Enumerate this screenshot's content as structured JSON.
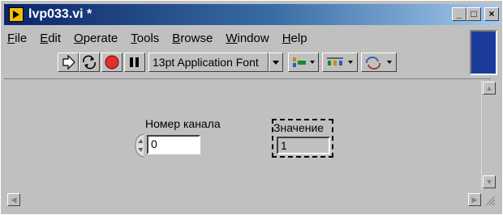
{
  "window": {
    "title": "lvp033.vi *",
    "min_glyph": "_",
    "max_glyph": "□",
    "close_glyph": "×"
  },
  "menu": {
    "items": [
      {
        "label": "File",
        "accel": "F",
        "rest": "ile"
      },
      {
        "label": "Edit",
        "accel": "E",
        "rest": "dit"
      },
      {
        "label": "Operate",
        "accel": "O",
        "rest": "perate"
      },
      {
        "label": "Tools",
        "accel": "T",
        "rest": "ools"
      },
      {
        "label": "Browse",
        "accel": "B",
        "rest": "rowse"
      },
      {
        "label": "Window",
        "accel": "W",
        "rest": "indow"
      },
      {
        "label": "Help",
        "accel": "H",
        "rest": "elp"
      }
    ]
  },
  "toolbar": {
    "font_select": "13pt Application Font"
  },
  "front_panel": {
    "control_label": "Номер канала",
    "control_value": "0",
    "indicator_label": "Значение",
    "indicator_value": "1"
  },
  "colors": {
    "titlebar_start": "#0a246a",
    "titlebar_end": "#a6caf0",
    "run_button_red": "#e03030"
  }
}
